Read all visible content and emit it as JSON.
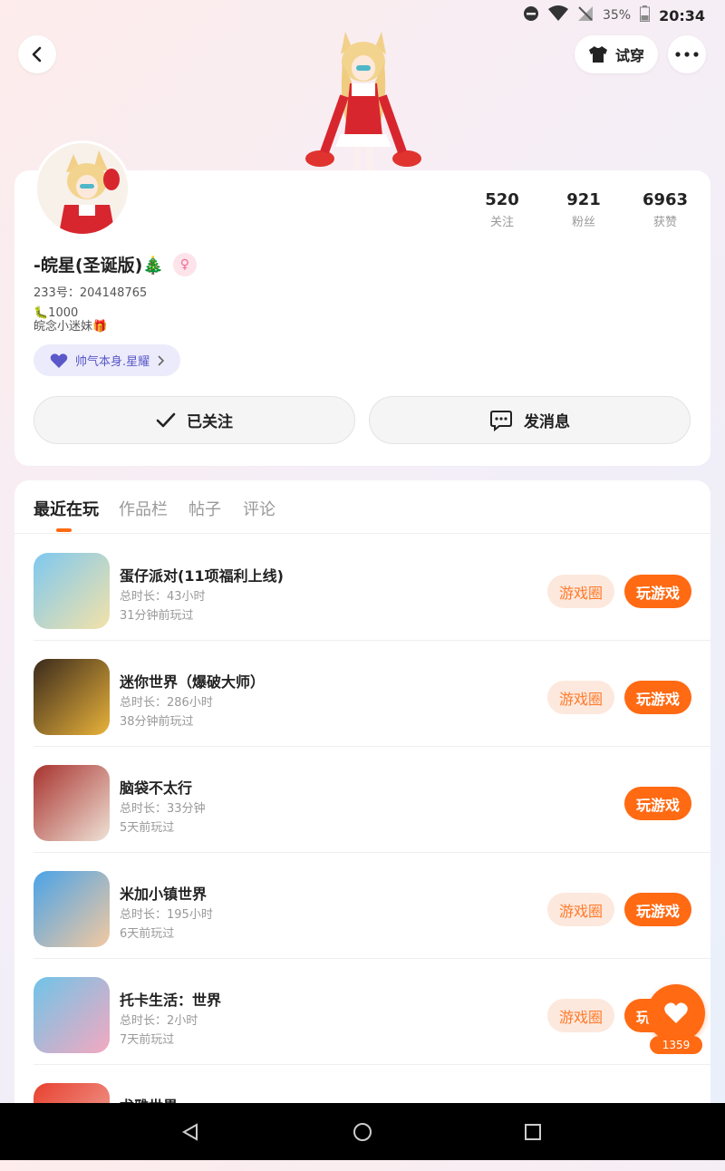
{
  "status_bar": {
    "battery": "35%",
    "time": "20:34"
  },
  "header": {
    "try_on_label": "试穿"
  },
  "profile": {
    "stats": [
      {
        "value": "520",
        "label": "关注"
      },
      {
        "value": "921",
        "label": "粉丝"
      },
      {
        "value": "6963",
        "label": "获赞"
      }
    ],
    "nickname": "-皖星(圣诞版)🎄",
    "gender_symbol": "♀",
    "uid": "233号：204148765",
    "bio_line1": "🐛1000",
    "bio_line2": "皖念小迷妹🎁",
    "badge": "帅气本身.星耀",
    "follow_label": "已关注",
    "message_label": "发消息"
  },
  "tabs": [
    "最近在玩",
    "作品栏",
    "帖子",
    "评论"
  ],
  "games": [
    {
      "title": "蛋仔派对(11项福利上线)",
      "duration": "总时长：43小时",
      "last_played": "31分钟前玩过",
      "circle": "游戏圈",
      "play": "玩游戏",
      "color1": "#7ec8f0",
      "color2": "#f3e2a8"
    },
    {
      "title": "迷你世界（爆破大师）",
      "duration": "总时长：286小时",
      "last_played": "38分钟前玩过",
      "circle": "游戏圈",
      "play": "玩游戏",
      "color1": "#3a2a1c",
      "color2": "#e9b23a"
    },
    {
      "title": "脑袋不太行",
      "duration": "总时长：33分钟",
      "last_played": "5天前玩过",
      "circle": "",
      "play": "玩游戏",
      "color1": "#a8322e",
      "color2": "#efe2d6"
    },
    {
      "title": "米加小镇世界",
      "duration": "总时长：195小时",
      "last_played": "6天前玩过",
      "circle": "游戏圈",
      "play": "玩游戏",
      "color1": "#4aa3e8",
      "color2": "#f3c9a0"
    },
    {
      "title": "托卡生活：世界",
      "duration": "总时长：2小时",
      "last_played": "7天前玩过",
      "circle": "游戏圈",
      "play": "玩游戏",
      "color1": "#6fc4e8",
      "color2": "#f5a8c0"
    },
    {
      "title": "尤雅世界",
      "duration": "",
      "last_played": "",
      "circle": "",
      "play": "",
      "color1": "#e8402e",
      "color2": "#f0b0a8"
    }
  ],
  "like_count": "1359"
}
